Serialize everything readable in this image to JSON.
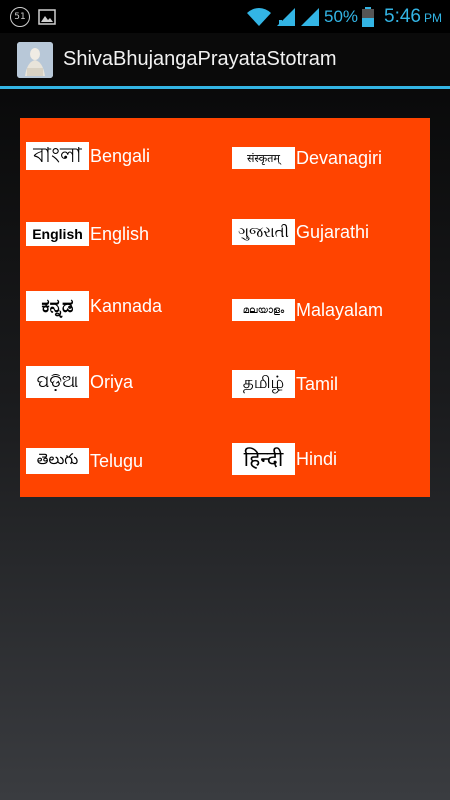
{
  "status_bar": {
    "notification_count": "51",
    "battery_percent": "50%",
    "time": "5:46",
    "ampm": "PM"
  },
  "action_bar": {
    "title": "ShivaBhujangaPrayataStotram"
  },
  "languages": [
    {
      "script": "বাংলা",
      "label": "Bengali"
    },
    {
      "script": "संस्कृतम्",
      "label": "Devanagiri"
    },
    {
      "script": "English",
      "label": "English"
    },
    {
      "script": "ગુજરાતી",
      "label": "Gujarathi"
    },
    {
      "script": "ಕನ್ನಡ",
      "label": "Kannada"
    },
    {
      "script": "മലയാളം",
      "label": "Malayalam"
    },
    {
      "script": "ପଡ଼ିଆ",
      "label": "Oriya"
    },
    {
      "script": "தமிழ்",
      "label": "Tamil"
    },
    {
      "script": "తెలుగు",
      "label": "Telugu"
    },
    {
      "script": "हिन्दी",
      "label": "Hindi"
    }
  ],
  "colors": {
    "accent": "#33b5e5",
    "panel": "#ff4400"
  }
}
